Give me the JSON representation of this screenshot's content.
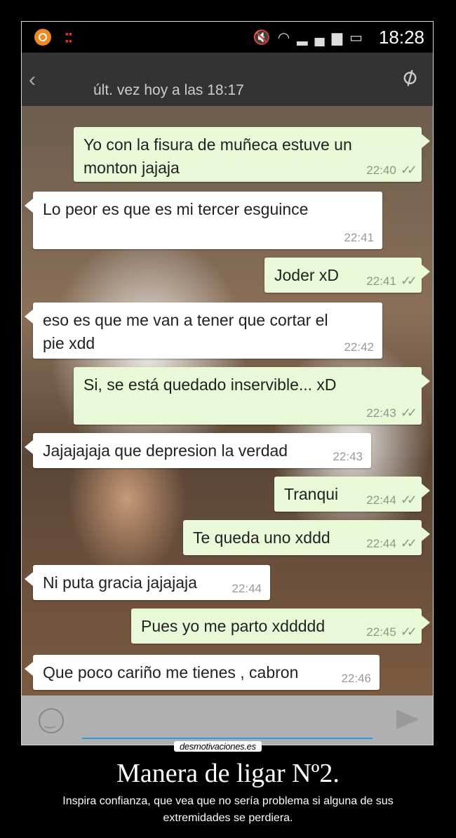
{
  "status_bar": {
    "time": "18:28"
  },
  "header": {
    "last_seen": "últ. vez hoy a las 18:17"
  },
  "messages": [
    {
      "text": "Yo con la fisura de muñeca estuve un\nmonton jajaja",
      "time": "22:40",
      "direction": "out"
    },
    {
      "text": "Lo peor es que es mi tercer esguince",
      "time": "22:41",
      "direction": "in"
    },
    {
      "text": "Joder xD",
      "time": "22:41",
      "direction": "out"
    },
    {
      "text": "eso es que me van a tener que cortar el\npie xdd",
      "time": "22:42",
      "direction": "in"
    },
    {
      "text": "Si, se está quedado inservible... xD",
      "time": "22:43",
      "direction": "out"
    },
    {
      "text": "Jajajajaja que depresion la verdad",
      "time": "22:43",
      "direction": "in"
    },
    {
      "text": "Tranqui",
      "time": "22:44",
      "direction": "out"
    },
    {
      "text": "Te queda uno xddd",
      "time": "22:44",
      "direction": "out"
    },
    {
      "text": "Ni puta gracia jajajaja",
      "time": "22:44",
      "direction": "in"
    },
    {
      "text": "Pues yo me parto xddddd",
      "time": "22:45",
      "direction": "out"
    },
    {
      "text": "Que poco cariño me tienes , cabron",
      "time": "22:46",
      "direction": "in"
    }
  ],
  "watermark": "desmotivaciones.es",
  "caption": {
    "title": "Manera de ligar Nº2.",
    "text": "Inspira confianza, que vea que no sería problema si alguna de sus extremidades se perdiera."
  },
  "colors": {
    "outgoing_bubble": "#e9f8d6",
    "incoming_bubble": "#ffffff",
    "header": "#333333",
    "input_underline": "#2a9adf"
  },
  "icons": [
    "app-notification-icon",
    "bbm-icon",
    "mute-icon",
    "wifi-icon",
    "signal-icon",
    "battery-icon",
    "back-icon",
    "attach-icon",
    "emoji-icon",
    "send-icon",
    "read-ticks-icon"
  ]
}
